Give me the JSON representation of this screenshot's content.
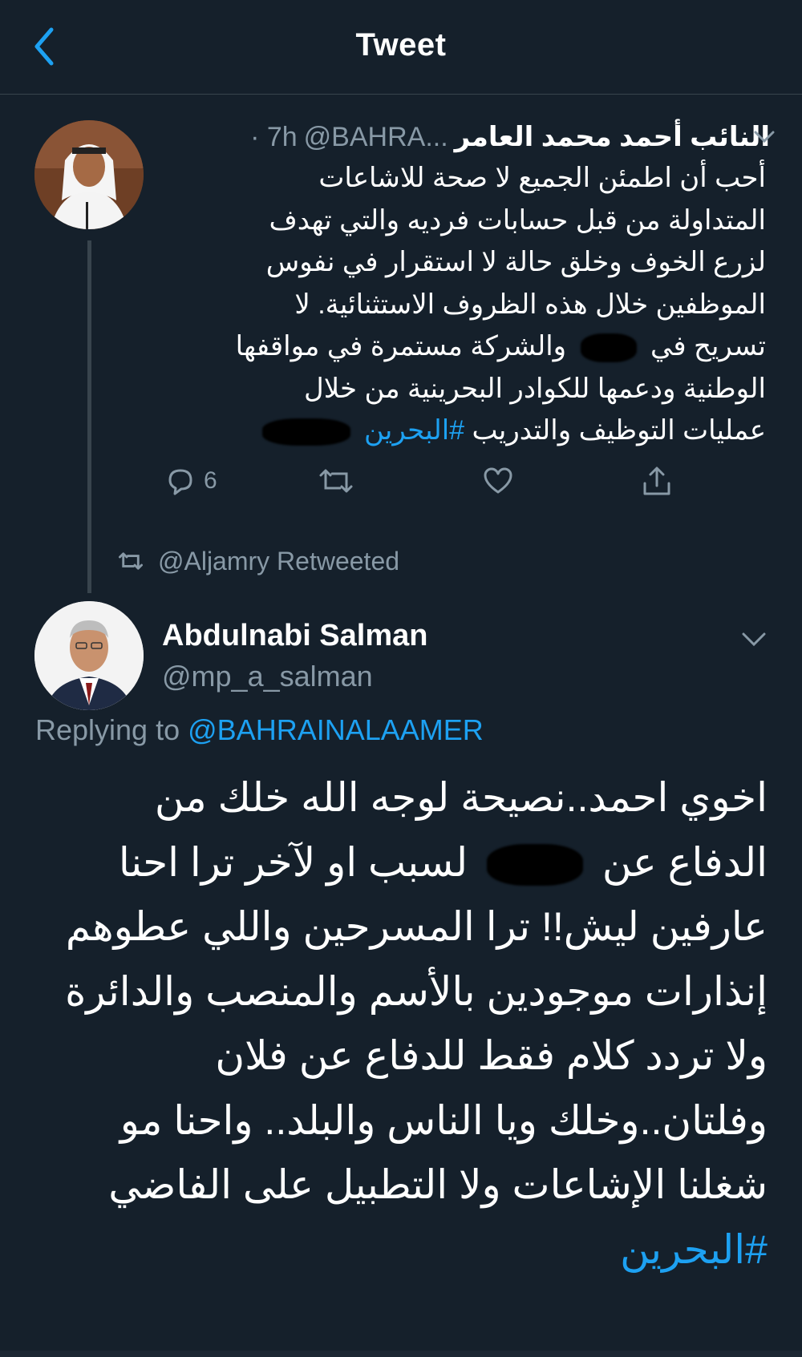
{
  "header": {
    "title": "Tweet"
  },
  "tweet1": {
    "author_name": "النائب أحمد محمد العامر",
    "handle": "@BAHRA...",
    "time": "· 7h",
    "body_lines": [
      "أحب أن اطمئن الجميع لا صحة للاشاعات",
      "المتداولة من قبل حسابات فرديه والتي تهدف",
      "لزرع الخوف وخلق حالة لا استقرار في نفوس",
      "الموظفين خلال هذه الظروف الاستثنائية. لا",
      "تسريح في",
      "والشركة مستمرة في مواقفها",
      "الوطنية ودعمها للكوادر البحرينية من خلال",
      "عمليات التوظيف والتدريب",
      "#البحرين"
    ],
    "reply_count": "6"
  },
  "retweet_notice": "@Aljamry Retweeted",
  "tweet2": {
    "author_name": "Abdulnabi Salman",
    "handle": "@mp_a_salman",
    "replying_label": "Replying to",
    "replying_to": "@BAHRAINALAAMER",
    "body_lines": [
      "اخوي احمد..نصيحة لوجه الله خلك من",
      "الدفاع عن",
      "لسبب او لآخر ترا احنا",
      "عارفين ليش!! ترا المسرحين واللي عطوهم",
      "إنذارات موجودين بالأسم والمنصب والدائرة",
      "ولا تردد كلام فقط للدفاع عن فلان",
      "وفلتان..وخلك ويا الناس والبلد.. واحنا مو",
      "شغلنا الإشاعات ولا التطبيل على الفاضي",
      "#البحرين"
    ]
  },
  "colors": {
    "background": "#15202b",
    "accent": "#1da1f2",
    "muted": "#8899a6",
    "divider": "#38444d"
  },
  "icons": [
    "back-arrow-icon",
    "chevron-down-icon",
    "reply-icon",
    "retweet-icon",
    "like-icon",
    "share-icon"
  ]
}
